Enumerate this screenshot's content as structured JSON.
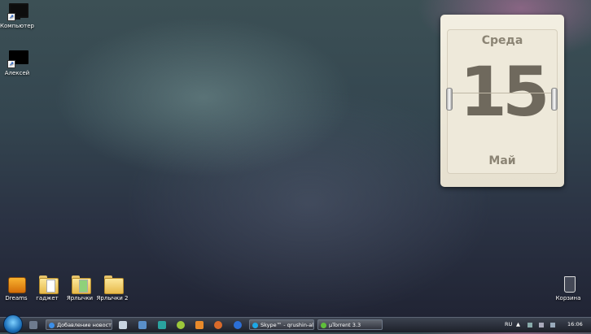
{
  "desktop_icons": {
    "computer": "Компьютер",
    "user": "Алексей",
    "dreams": "Dreams",
    "gadget": "гаджет",
    "shortcuts": "Ярлычки",
    "shortcuts2": "Ярлычки 2",
    "recycle_bin": "Корзина"
  },
  "calendar": {
    "weekday": "Среда",
    "day": "15",
    "month": "Май"
  },
  "taskbar": {
    "tasks": [
      {
        "label": "Добавление новост...",
        "icon": "ie-icon"
      },
      {
        "label": "Skype™ - qrushin-alix...",
        "icon": "skype-icon"
      },
      {
        "label": "µTorrent 3.3",
        "icon": "utorrent-icon"
      }
    ],
    "language": "RU",
    "clock": "16:06"
  },
  "colors": {
    "taskbar": "#1d2029",
    "calendar_bg": "#eee9da",
    "calendar_text": "#6f695d"
  }
}
